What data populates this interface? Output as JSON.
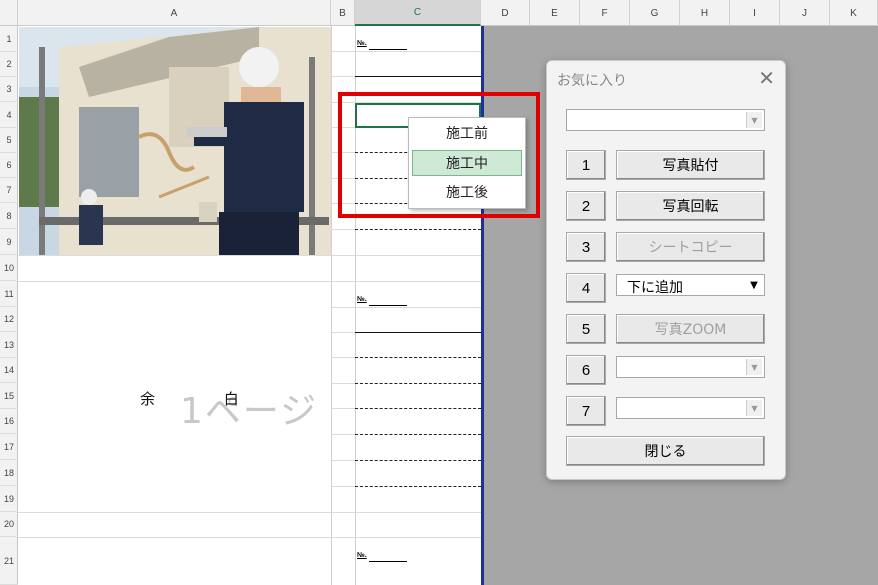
{
  "columns": [
    {
      "label": "A"
    },
    {
      "label": "B"
    },
    {
      "label": "C"
    },
    {
      "label": "D"
    },
    {
      "label": "E"
    },
    {
      "label": "F"
    },
    {
      "label": "G"
    },
    {
      "label": "H"
    },
    {
      "label": "I"
    },
    {
      "label": "J"
    },
    {
      "label": "K"
    }
  ],
  "rows": [
    "1",
    "2",
    "3",
    "4",
    "5",
    "6",
    "7",
    "8",
    "9",
    "10",
    "11",
    "12",
    "13",
    "14",
    "15",
    "16",
    "17",
    "18",
    "19",
    "20",
    "21"
  ],
  "sheet": {
    "no_label": "№.",
    "yohaku": "余 白",
    "page_watermark": "1ページ"
  },
  "dropdown": {
    "items": [
      "施工前",
      "施工中",
      "施工後"
    ],
    "highlighted": "施工中"
  },
  "dialog": {
    "title": "お気に入り",
    "close_glyph": "✕",
    "top_combo_value": "",
    "buttons": [
      {
        "num": "1",
        "label": "写真貼付",
        "enabled": true
      },
      {
        "num": "2",
        "label": "写真回転",
        "enabled": true
      },
      {
        "num": "3",
        "label": "シートコピー",
        "enabled": false
      },
      {
        "num": "4",
        "label": "下に追加",
        "kind": "combo"
      },
      {
        "num": "5",
        "label": "写真ZOOM",
        "enabled": false
      },
      {
        "num": "6",
        "label": "",
        "kind": "combo"
      },
      {
        "num": "7",
        "label": "",
        "kind": "combo"
      }
    ],
    "close_button": "閉じる"
  },
  "colors": {
    "highlight_box": "#e00000",
    "excel_green": "#217346",
    "print_border": "#1f2fa0"
  }
}
